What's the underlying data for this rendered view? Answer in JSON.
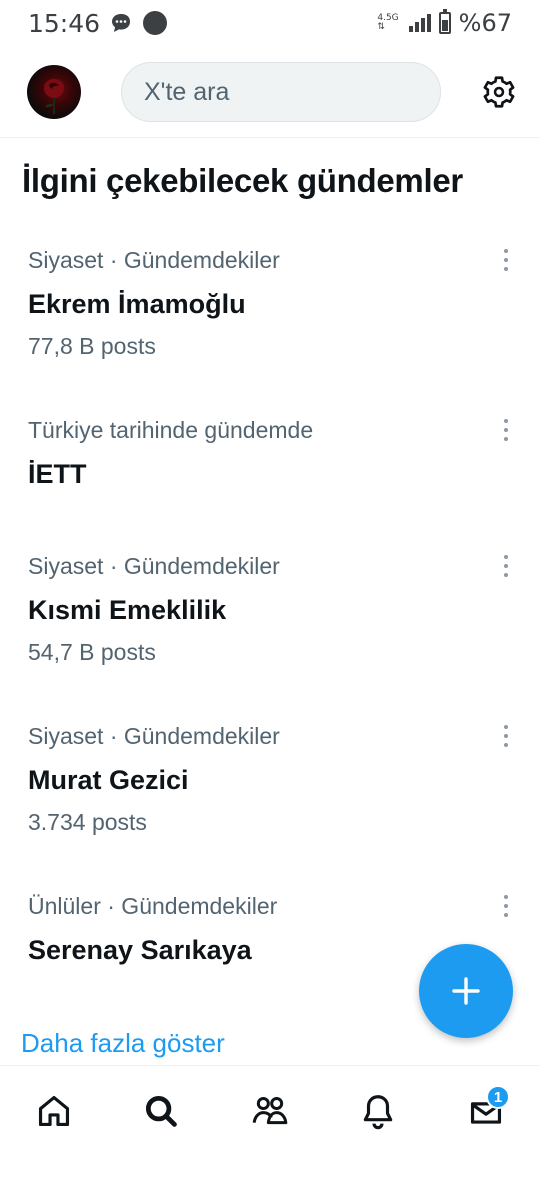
{
  "status_bar": {
    "time": "15:46",
    "network": "4.5G",
    "battery_label": "%67",
    "icons": [
      "chat-bubble-icon",
      "circle-notification-icon",
      "signal-icon",
      "battery-icon"
    ]
  },
  "header": {
    "search_placeholder": "X'te ara",
    "icons": [
      "avatar",
      "gear-icon"
    ]
  },
  "section_title": "İlgini çekebilecek gündemler",
  "trends": [
    {
      "meta": "Siyaset · Gündemdekiler",
      "name": "Ekrem İmamoğlu",
      "count": "77,8 B posts"
    },
    {
      "meta": "Türkiye tarihinde gündemde",
      "name": "İETT",
      "count": ""
    },
    {
      "meta": "Siyaset · Gündemdekiler",
      "name": "Kısmi Emeklilik",
      "count": "54,7 B posts"
    },
    {
      "meta": "Siyaset · Gündemdekiler",
      "name": "Murat Gezici",
      "count": "3.734 posts"
    },
    {
      "meta": "Ünlüler · Gündemdekiler",
      "name": "Serenay Sarıkaya",
      "count": ""
    }
  ],
  "show_more": "Daha fazla göster",
  "bottom_nav": {
    "items": [
      "home-icon",
      "search-icon",
      "communities-icon",
      "notifications-icon",
      "messages-icon"
    ],
    "messages_badge": "1"
  },
  "colors": {
    "accent": "#1d9bf0",
    "secondary_text": "#536471",
    "primary_text": "#0f1419"
  }
}
